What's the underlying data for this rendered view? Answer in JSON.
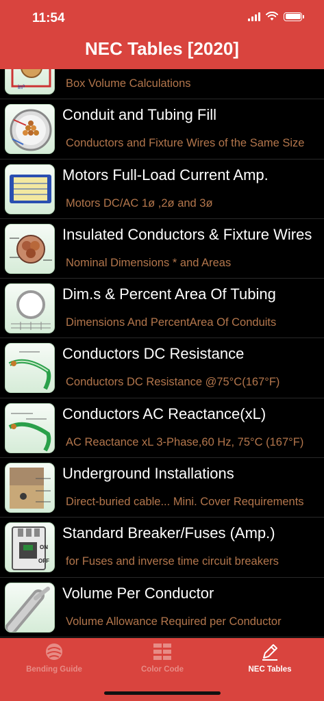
{
  "status": {
    "time": "11:54"
  },
  "nav": {
    "title": "NEC Tables [2020]"
  },
  "rows": [
    {
      "title": "",
      "subtitle": "Box Volume Calculations",
      "icon": "box-volume-icon"
    },
    {
      "title": "Conduit and Tubing Fill",
      "subtitle": "Conductors and Fixture Wires of the Same Size",
      "icon": "conduit-fill-icon"
    },
    {
      "title": "Motors Full-Load Current Amp.",
      "subtitle": "Motors DC/AC 1ø ,2ø and 3ø",
      "icon": "motor-nameplate-icon"
    },
    {
      "title": "Insulated Conductors & Fixture  Wires",
      "subtitle": "Nominal Dimensions * and Areas",
      "icon": "insulated-conductor-icon"
    },
    {
      "title": "Dim.s & Percent Area Of Tubing",
      "subtitle": "Dimensions And PercentArea Of Conduits",
      "icon": "tubing-area-icon"
    },
    {
      "title": "Conductors DC Resistance",
      "subtitle": "Conductors DC Resistance @75°C(167°F)",
      "icon": "dc-resistance-icon"
    },
    {
      "title": "Conductors AC Reactance(xL)",
      "subtitle": "AC Reactance xL 3-Phase,60 Hz, 75°C (167°F)",
      "icon": "ac-reactance-icon"
    },
    {
      "title": "Underground Installations",
      "subtitle": "Direct-buried cable... Mini. Cover Requirements",
      "icon": "underground-icon"
    },
    {
      "title": "Standard Breaker/Fuses (Amp.)",
      "subtitle": "for Fuses and inverse time circuit breakers",
      "icon": "breaker-icon"
    },
    {
      "title": "Volume Per Conductor",
      "subtitle": "Volume Allowance Required per Conductor",
      "icon": "cable-icon"
    }
  ],
  "tabs": [
    {
      "label": "Bending Guide",
      "icon": "bending-guide-icon",
      "active": false
    },
    {
      "label": "Color Code",
      "icon": "color-code-icon",
      "active": false
    },
    {
      "label": "NEC Tables",
      "icon": "pencil-icon",
      "active": true
    }
  ],
  "colors": {
    "accent": "#d9443e",
    "subtitle": "#b3764c",
    "background": "#000000"
  }
}
